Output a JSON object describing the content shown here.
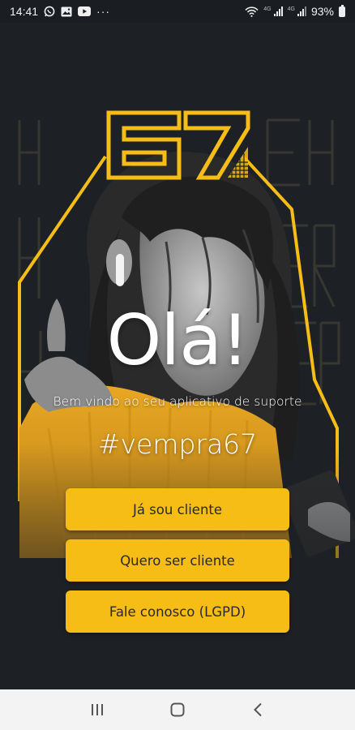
{
  "status_bar": {
    "time": "14:41",
    "notification_icons": [
      "whatsapp-icon",
      "gallery-icon",
      "youtube-icon"
    ],
    "more_indicator": "···",
    "battery": "93%",
    "network_badges": [
      "4G",
      "4G"
    ]
  },
  "brand": {
    "logo_text": "67",
    "accent_color": "#f6bd16"
  },
  "greeting": {
    "title": "Olá!",
    "subtitle": "Bem vindo ao seu aplicativo de suporte",
    "hashtag": "#vempra67"
  },
  "actions": {
    "existing_client": "Já sou cliente",
    "become_client": "Quero ser cliente",
    "contact_lgpd": "Fale conosco (LGPD)"
  },
  "nav": {
    "recent_apps": "recent-apps-icon",
    "home": "home-icon",
    "back": "back-icon"
  }
}
